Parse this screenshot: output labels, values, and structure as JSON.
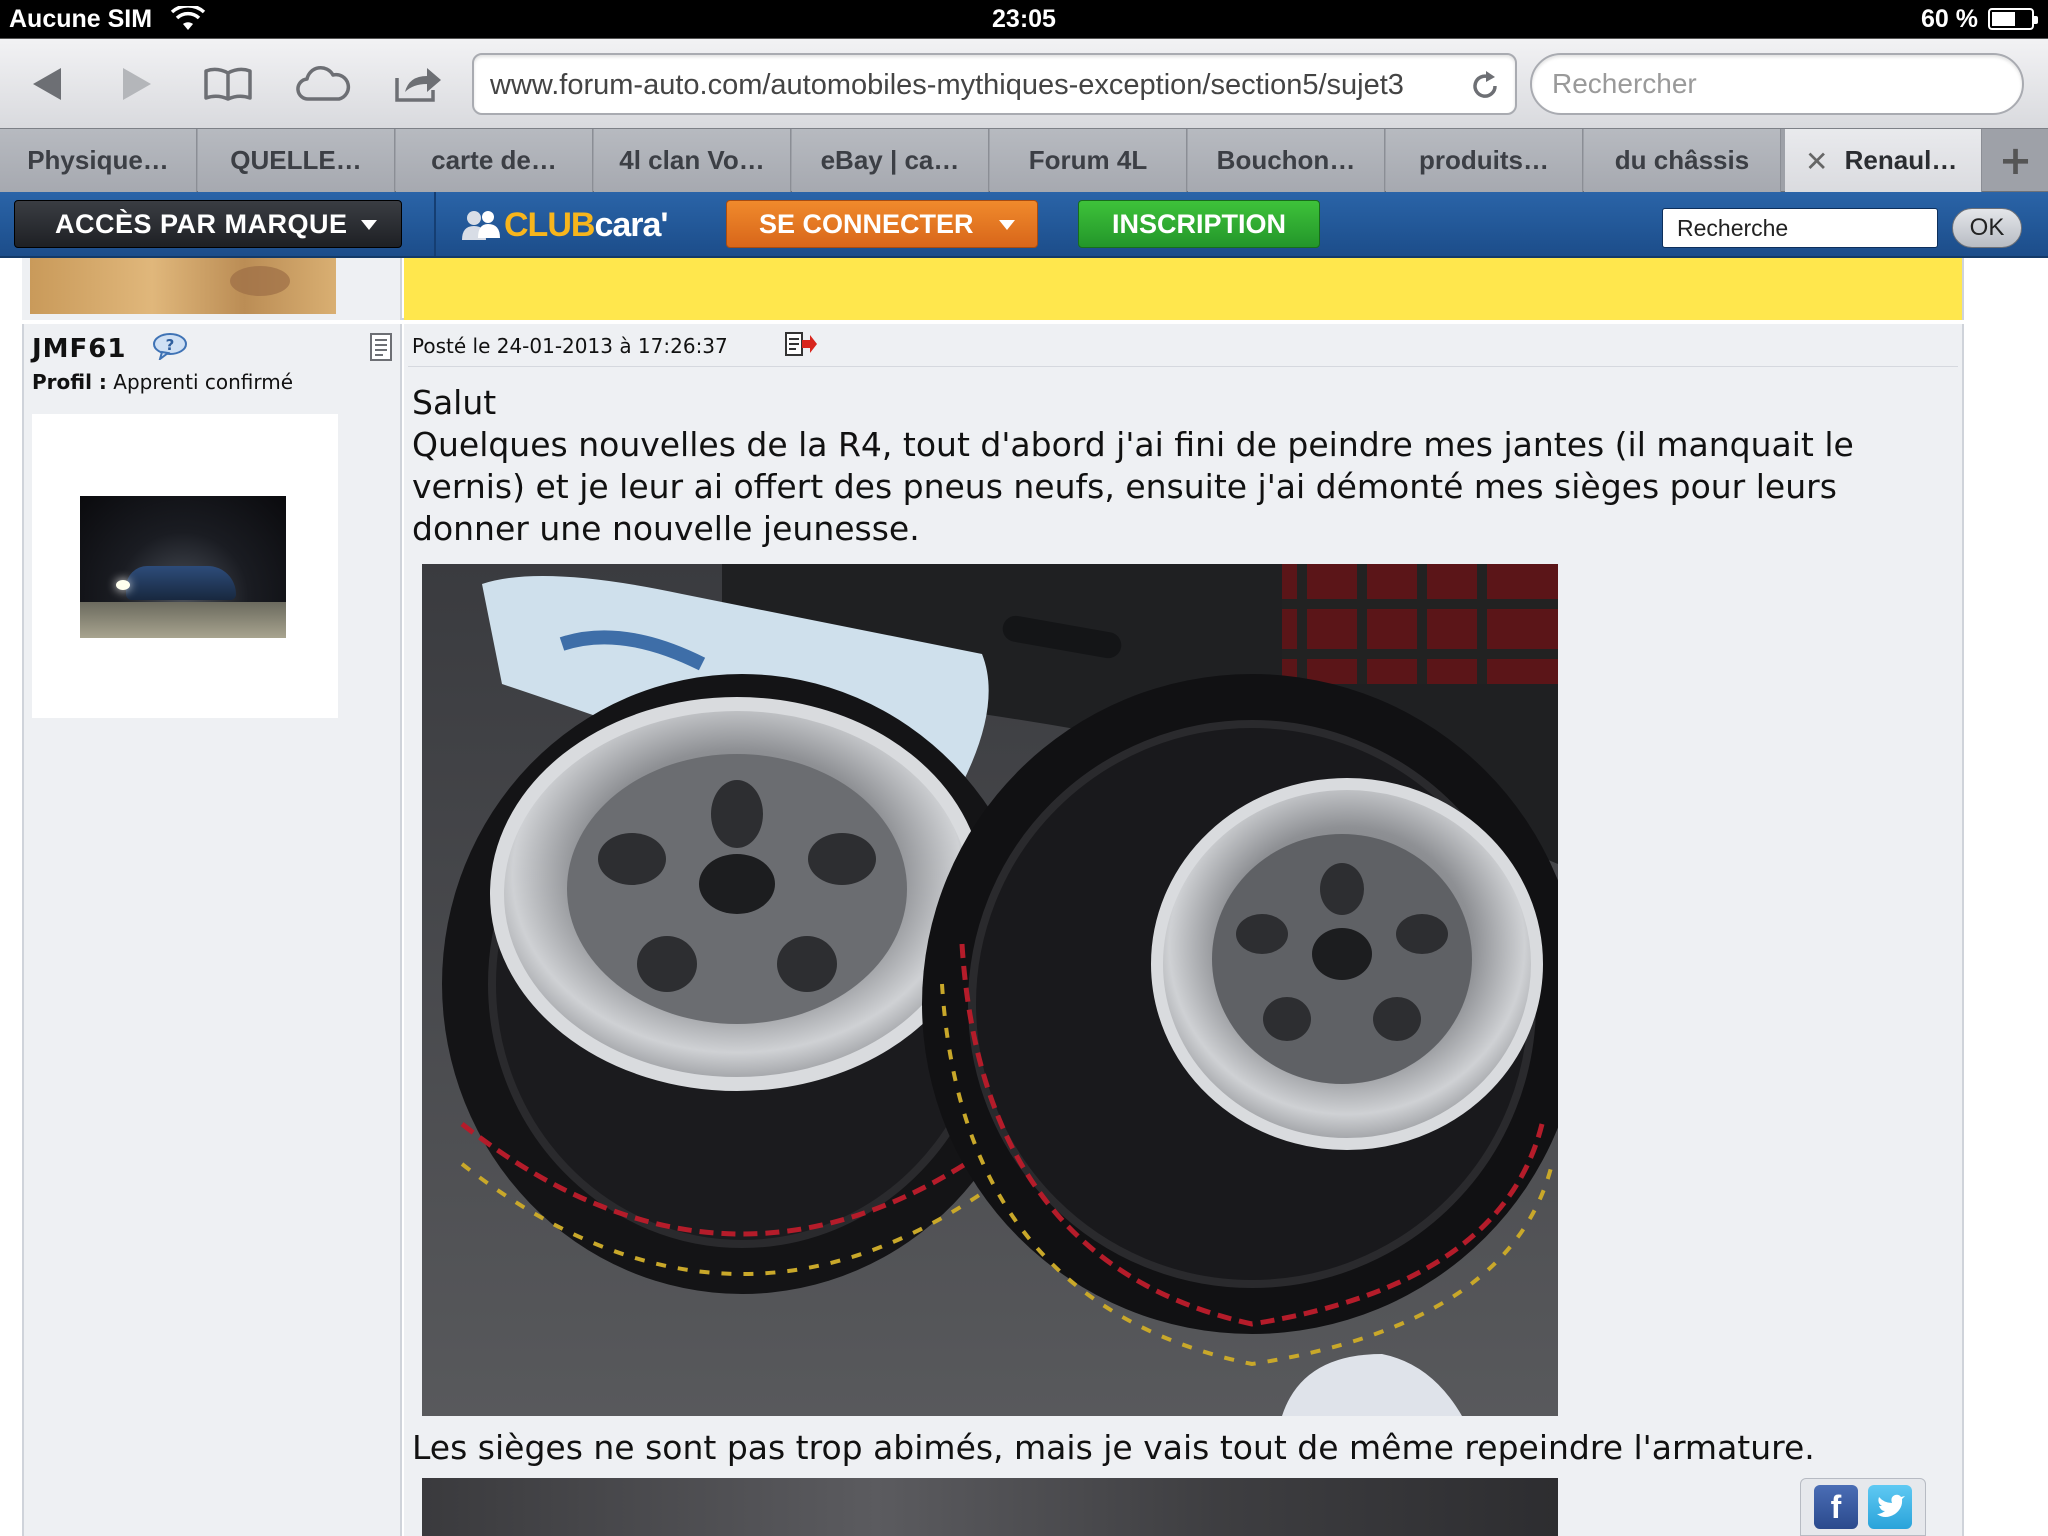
{
  "status_bar": {
    "carrier": "Aucune SIM",
    "time": "23:05",
    "battery": "60 %",
    "battery_level": 0.6
  },
  "toolbar": {
    "url": "www.forum-auto.com/automobiles-mythiques-exception/section5/sujet3",
    "search_placeholder": "Rechercher"
  },
  "tabs": [
    {
      "label": "Physique…"
    },
    {
      "label": "QUELLE…"
    },
    {
      "label": "carte de…"
    },
    {
      "label": "4l clan Vo…"
    },
    {
      "label": "eBay | ca…"
    },
    {
      "label": "Forum 4L"
    },
    {
      "label": "Bouchon…"
    },
    {
      "label": "produits…"
    },
    {
      "label": "du châssis"
    },
    {
      "label": "Renaul…",
      "active": true
    }
  ],
  "site_nav": {
    "brand_menu": "ACCÈS PAR MARQUE",
    "logo_club": "CLUB",
    "logo_cara": "cara'",
    "login": "SE CONNECTER",
    "signup": "INSCRIPTION",
    "search_value": "Recherche",
    "ok": "OK"
  },
  "post": {
    "author": "JMF61",
    "profile_label": "Profil :",
    "profile_value": "Apprenti confirmé",
    "posted": "Posté le 24-01-2013 à 17:26:37",
    "greeting": "Salut",
    "body": "Quelques nouvelles de la R4, tout d'abord j'ai fini de peindre mes jantes (il manquait le vernis) et je leur ai offert des pneus neufs, ensuite j'ai démonté mes sièges pour leurs donner une nouvelle jeunesse.",
    "caption_2": "Les sièges ne sont pas trop abimés, mais je vais tout de même repeindre l'armature."
  },
  "social": {
    "facebook": "f"
  },
  "colors": {
    "nav_blue": "#1c4d8a",
    "login_orange": "#e0701f",
    "signup_green": "#2aa62f",
    "highlight_yellow": "#ffe74d"
  }
}
